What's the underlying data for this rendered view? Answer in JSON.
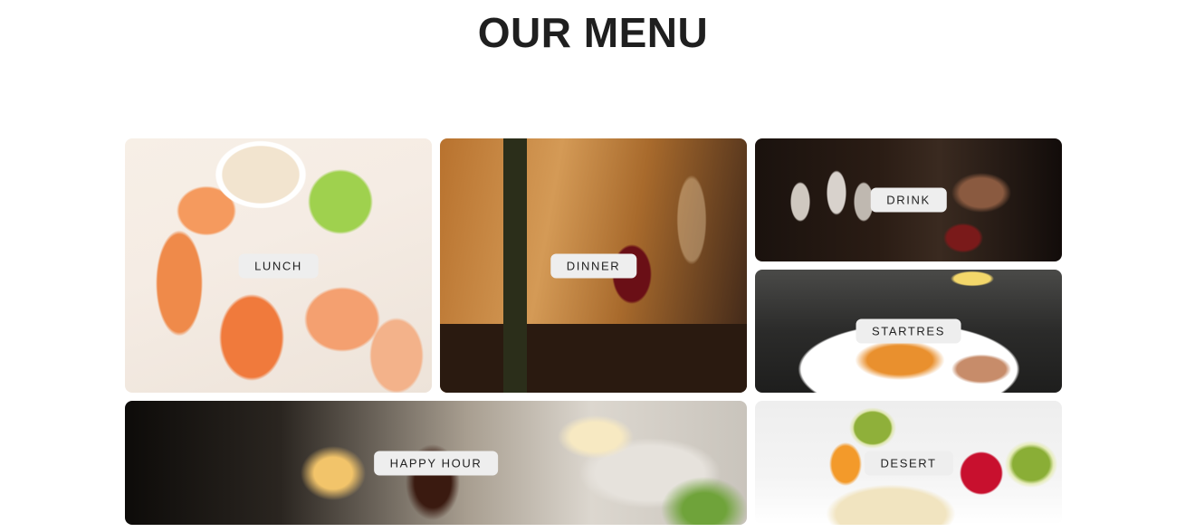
{
  "page": {
    "title": "OUR MENU"
  },
  "menu": {
    "tiles": [
      {
        "id": "lunch",
        "label": "LUNCH"
      },
      {
        "id": "dinner",
        "label": "DINNER"
      },
      {
        "id": "drink",
        "label": "DRINK"
      },
      {
        "id": "startres",
        "label": "STARTRES"
      },
      {
        "id": "happy_hour",
        "label": "HAPPY HOUR"
      },
      {
        "id": "desert",
        "label": "DESERT"
      }
    ]
  },
  "colors": {
    "title": "#1f1f1f",
    "label_background": "#eeeeee",
    "label_text": "#222222",
    "page_background": "#ffffff"
  }
}
